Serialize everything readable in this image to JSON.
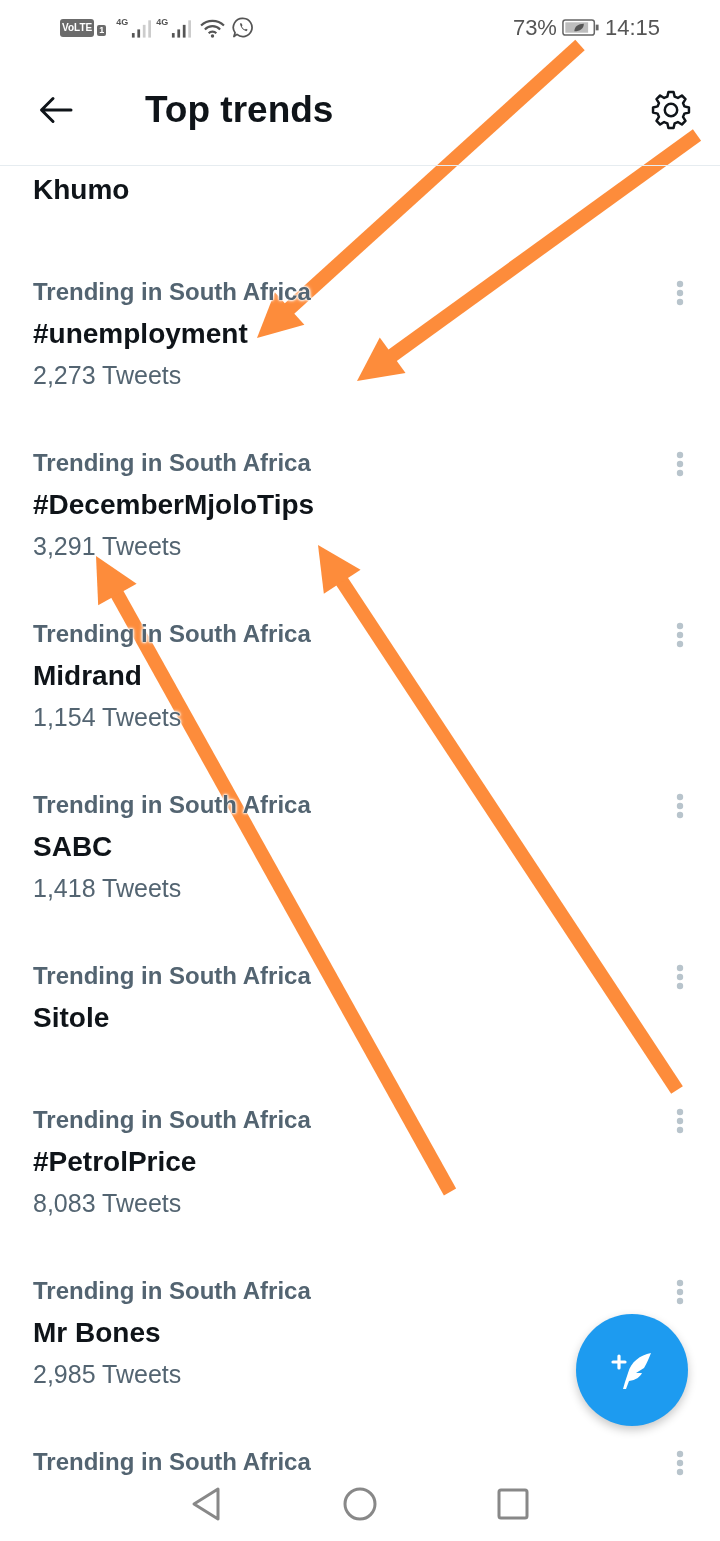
{
  "status_bar": {
    "volte": "VoLTE",
    "sim_slot": "1",
    "network_1": "4G",
    "network_2": "4G",
    "battery": "73%",
    "time": "14:15"
  },
  "header": {
    "title": "Top trends"
  },
  "trends": [
    {
      "name": "Khumo"
    },
    {
      "category": "Trending in South Africa",
      "name": "#unemployment",
      "count": "2,273 Tweets"
    },
    {
      "category": "Trending in South Africa",
      "name": "#DecemberMjoloTips",
      "count": "3,291 Tweets"
    },
    {
      "category": "Trending in South Africa",
      "name": "Midrand",
      "count": "1,154 Tweets"
    },
    {
      "category": "Trending in South Africa",
      "name": "SABC",
      "count": "1,418 Tweets"
    },
    {
      "category": "Trending in South Africa",
      "name": "Sitole"
    },
    {
      "category": "Trending in South Africa",
      "name": "#PetrolPrice",
      "count": "8,083 Tweets"
    },
    {
      "category": "Trending in South Africa",
      "name": "Mr Bones",
      "count": "2,985 Tweets"
    },
    {
      "category": "Trending in South Africa"
    }
  ],
  "annotations": [
    {
      "kind": "arrow"
    },
    {
      "kind": "arrow"
    },
    {
      "kind": "arrow"
    },
    {
      "kind": "arrow"
    }
  ]
}
